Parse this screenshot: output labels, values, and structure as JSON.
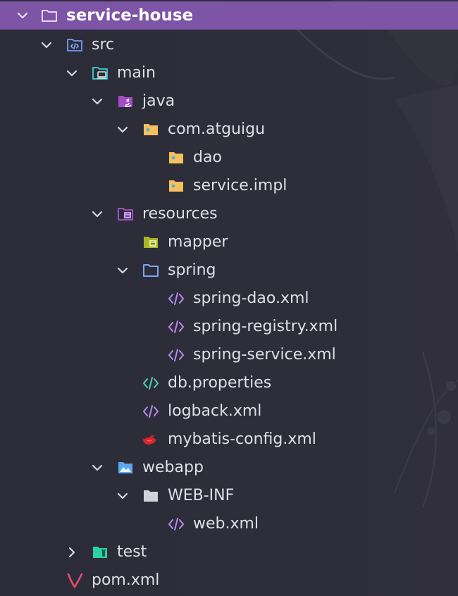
{
  "project_tree": {
    "root": {
      "label": "service-house",
      "icon": "folder-outline-icon",
      "expanded": true
    },
    "items": [
      {
        "label": "src",
        "icon": "source-folder-icon",
        "expanded": true
      },
      {
        "label": "main",
        "icon": "main-folder-icon",
        "expanded": true
      },
      {
        "label": "java",
        "icon": "java-folder-icon",
        "expanded": true
      },
      {
        "label": "com.atguigu",
        "icon": "package-folder-icon",
        "expanded": true
      },
      {
        "label": "dao",
        "icon": "package-folder-icon"
      },
      {
        "label": "service.impl",
        "icon": "package-folder-icon"
      },
      {
        "label": "resources",
        "icon": "resources-folder-icon",
        "expanded": true
      },
      {
        "label": "mapper",
        "icon": "mapper-folder-icon"
      },
      {
        "label": "spring",
        "icon": "folder-outline-icon",
        "expanded": true
      },
      {
        "label": "spring-dao.xml",
        "icon": "xml-file-icon"
      },
      {
        "label": "spring-registry.xml",
        "icon": "xml-file-icon"
      },
      {
        "label": "spring-service.xml",
        "icon": "xml-file-icon"
      },
      {
        "label": "db.properties",
        "icon": "properties-file-icon"
      },
      {
        "label": "logback.xml",
        "icon": "xml-file-icon"
      },
      {
        "label": "mybatis-config.xml",
        "icon": "mybatis-bird-icon"
      },
      {
        "label": "webapp",
        "icon": "webapp-folder-icon",
        "expanded": true
      },
      {
        "label": "WEB-INF",
        "icon": "folder-solid-icon",
        "expanded": true
      },
      {
        "label": "web.xml",
        "icon": "xml-file-icon"
      },
      {
        "label": "test",
        "icon": "test-folder-icon",
        "expanded": false
      },
      {
        "label": "pom.xml",
        "icon": "maven-icon"
      }
    ]
  },
  "colors": {
    "background": "#2c2d39",
    "root_highlight": "#7d54a6",
    "text": "#dfdfe6",
    "chevron": "#d7d7df",
    "xml_purple": "#b98bf0",
    "package_yellow": "#f7c05e",
    "test_green": "#2ad2a4",
    "webapp_blue": "#5aa8f0",
    "maven_red": "#e84a6e"
  }
}
